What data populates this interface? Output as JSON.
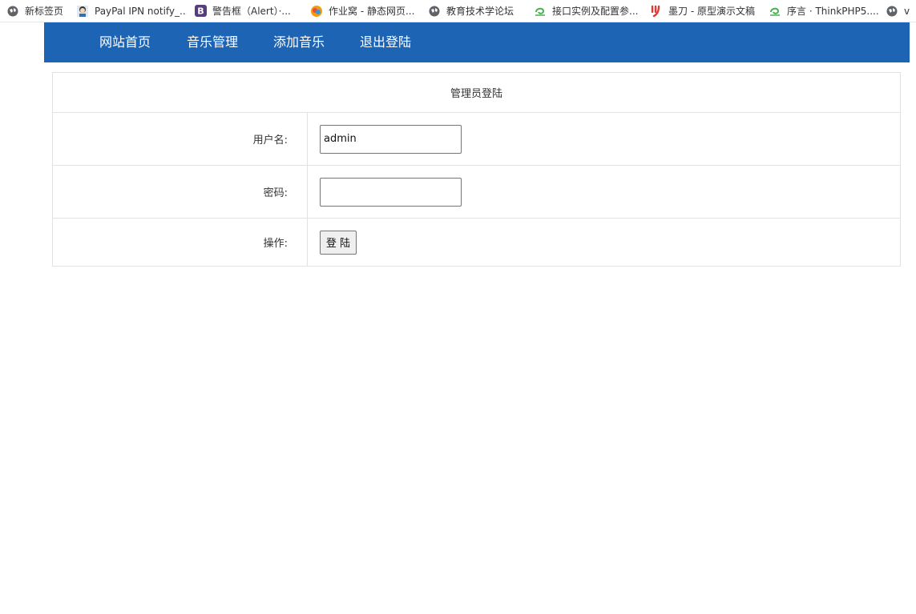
{
  "bookmarks": [
    {
      "label": "新标签页",
      "icon": "globe-icon"
    },
    {
      "label": "PayPal IPN notify_...",
      "icon": "avatar-icon"
    },
    {
      "label": "警告框（Alert）·...",
      "icon": "bootstrap-icon"
    },
    {
      "label": "作业窝 - 静态网页...",
      "icon": "colorful-logo-icon"
    },
    {
      "label": "教育技术学论坛",
      "icon": "globe-icon"
    },
    {
      "label": "接口实例及配置参...",
      "icon": "green-swirl-icon"
    },
    {
      "label": "墨刀 - 原型演示文稿",
      "icon": "modao-logo-icon"
    },
    {
      "label": "序言 · ThinkPHP5....",
      "icon": "green-swirl-icon"
    },
    {
      "label": "vi",
      "icon": "globe-icon"
    }
  ],
  "nav": {
    "items": [
      "网站首页",
      "音乐管理",
      "添加音乐",
      "退出登陆"
    ],
    "background": "#1e64b4"
  },
  "form": {
    "title": "管理员登陆",
    "username_label": "用户名:",
    "username_value": "admin",
    "password_label": "密码:",
    "password_value": "",
    "action_label": "操作:",
    "submit_label": "登 陆"
  }
}
